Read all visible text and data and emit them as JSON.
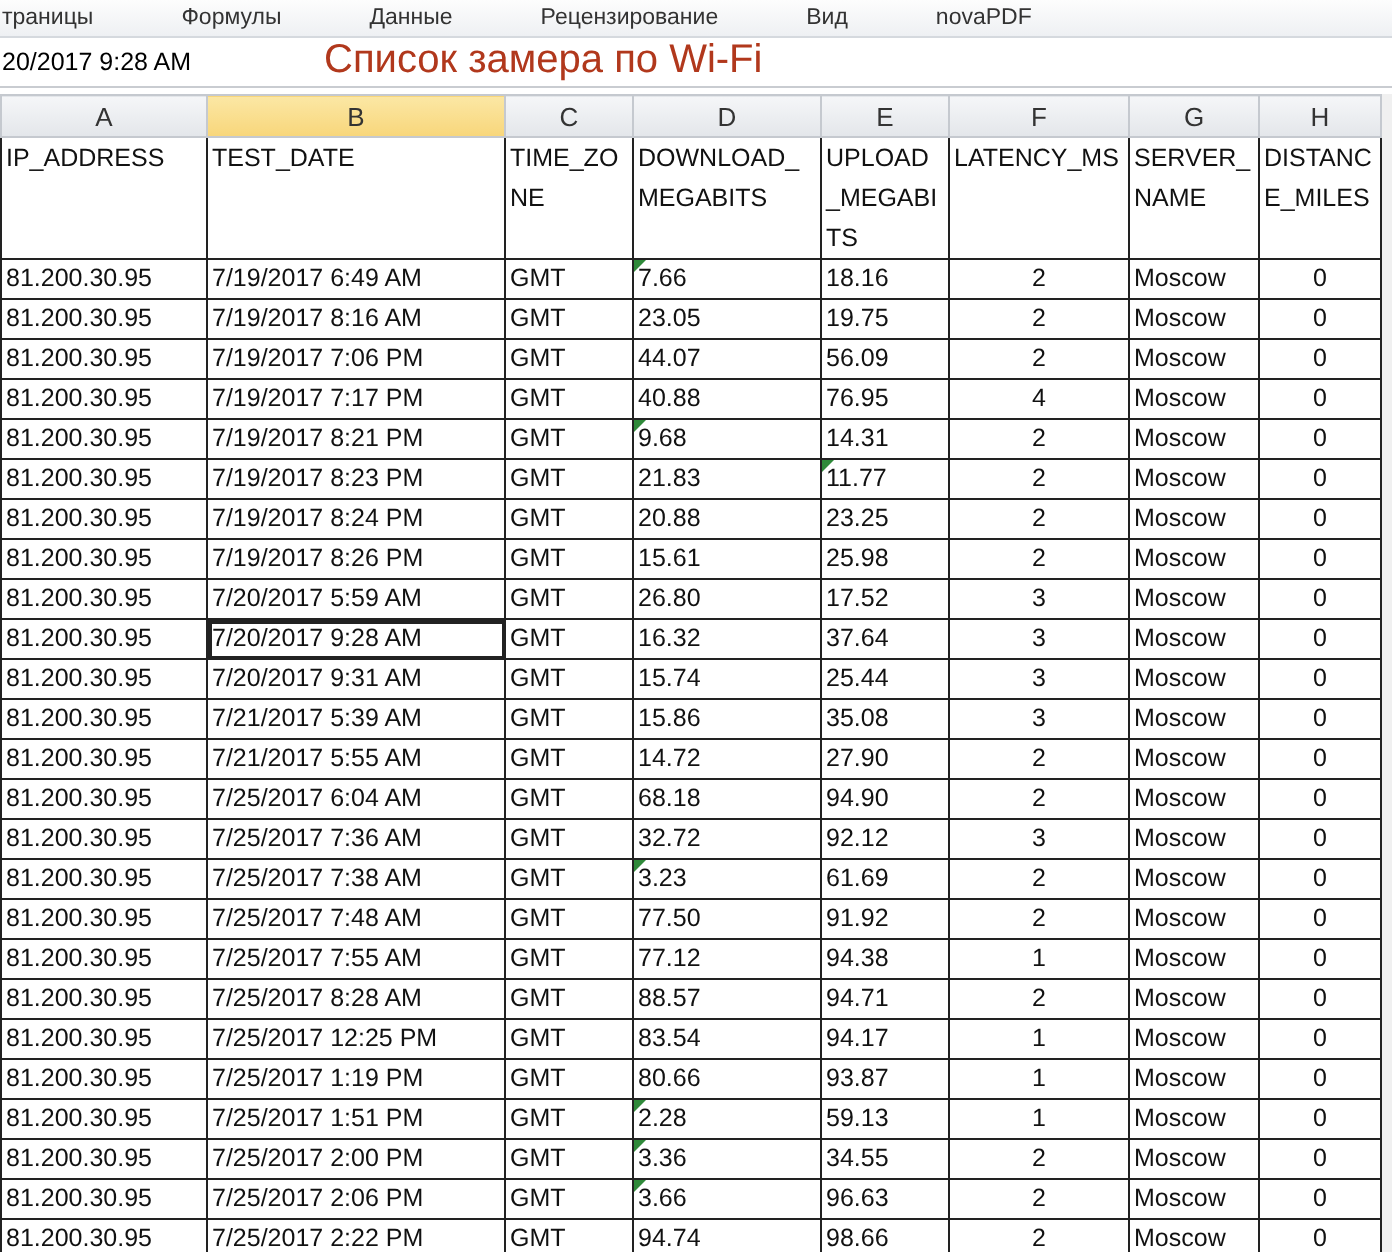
{
  "ribbon_tabs": [
    "траницы",
    "Формулы",
    "Данные",
    "Рецензирование",
    "Вид",
    "novaPDF"
  ],
  "formula_bar": {
    "value": "20/2017 9:28 AM"
  },
  "overlay_title": "Список замера по Wi-Fi",
  "column_letters": [
    {
      "label": "A",
      "selected": false
    },
    {
      "label": "B",
      "selected": true
    },
    {
      "label": "C",
      "selected": false
    },
    {
      "label": "D",
      "selected": false
    },
    {
      "label": "E",
      "selected": false
    },
    {
      "label": "F",
      "selected": false
    },
    {
      "label": "G",
      "selected": false
    },
    {
      "label": "H",
      "selected": false
    }
  ],
  "headers": [
    "IP_ADDRESS",
    "TEST_DATE",
    "TIME_ZO\nNE",
    "DOWNLOAD_\nMEGABITS",
    "UPLOAD\n_MEGABI\nTS",
    "LATENCY_MS",
    "SERVER_\nNAME",
    "DISTANC\nE_MILES"
  ],
  "rows": [
    {
      "ip": "81.200.30.95",
      "date": "7/19/2017 6:49 AM",
      "tz": "GMT",
      "download": "7.66",
      "upload": "18.16",
      "latency": "2",
      "server": "Moscow",
      "distance": "0",
      "download_flagged": true,
      "upload_flagged": false,
      "selected": false
    },
    {
      "ip": "81.200.30.95",
      "date": "7/19/2017 8:16 AM",
      "tz": "GMT",
      "download": "23.05",
      "upload": "19.75",
      "latency": "2",
      "server": "Moscow",
      "distance": "0",
      "download_flagged": false,
      "upload_flagged": false,
      "selected": false
    },
    {
      "ip": "81.200.30.95",
      "date": "7/19/2017 7:06 PM",
      "tz": "GMT",
      "download": "44.07",
      "upload": "56.09",
      "latency": "2",
      "server": "Moscow",
      "distance": "0",
      "download_flagged": false,
      "upload_flagged": false,
      "selected": false
    },
    {
      "ip": "81.200.30.95",
      "date": "7/19/2017 7:17 PM",
      "tz": "GMT",
      "download": "40.88",
      "upload": "76.95",
      "latency": "4",
      "server": "Moscow",
      "distance": "0",
      "download_flagged": false,
      "upload_flagged": false,
      "selected": false
    },
    {
      "ip": "81.200.30.95",
      "date": "7/19/2017 8:21 PM",
      "tz": "GMT",
      "download": "9.68",
      "upload": "14.31",
      "latency": "2",
      "server": "Moscow",
      "distance": "0",
      "download_flagged": true,
      "upload_flagged": false,
      "selected": false
    },
    {
      "ip": "81.200.30.95",
      "date": "7/19/2017 8:23 PM",
      "tz": "GMT",
      "download": "21.83",
      "upload": "11.77",
      "latency": "2",
      "server": "Moscow",
      "distance": "0",
      "download_flagged": false,
      "upload_flagged": true,
      "selected": false
    },
    {
      "ip": "81.200.30.95",
      "date": "7/19/2017 8:24 PM",
      "tz": "GMT",
      "download": "20.88",
      "upload": "23.25",
      "latency": "2",
      "server": "Moscow",
      "distance": "0",
      "download_flagged": false,
      "upload_flagged": false,
      "selected": false
    },
    {
      "ip": "81.200.30.95",
      "date": "7/19/2017 8:26 PM",
      "tz": "GMT",
      "download": "15.61",
      "upload": "25.98",
      "latency": "2",
      "server": "Moscow",
      "distance": "0",
      "download_flagged": false,
      "upload_flagged": false,
      "selected": false
    },
    {
      "ip": "81.200.30.95",
      "date": "7/20/2017 5:59 AM",
      "tz": "GMT",
      "download": "26.80",
      "upload": "17.52",
      "latency": "3",
      "server": "Moscow",
      "distance": "0",
      "download_flagged": false,
      "upload_flagged": false,
      "selected": false
    },
    {
      "ip": "81.200.30.95",
      "date": "7/20/2017 9:28 AM",
      "tz": "GMT",
      "download": "16.32",
      "upload": "37.64",
      "latency": "3",
      "server": "Moscow",
      "distance": "0",
      "download_flagged": false,
      "upload_flagged": false,
      "selected": true
    },
    {
      "ip": "81.200.30.95",
      "date": "7/20/2017 9:31 AM",
      "tz": "GMT",
      "download": "15.74",
      "upload": "25.44",
      "latency": "3",
      "server": "Moscow",
      "distance": "0",
      "download_flagged": false,
      "upload_flagged": false,
      "selected": false
    },
    {
      "ip": "81.200.30.95",
      "date": "7/21/2017 5:39 AM",
      "tz": "GMT",
      "download": "15.86",
      "upload": "35.08",
      "latency": "3",
      "server": "Moscow",
      "distance": "0",
      "download_flagged": false,
      "upload_flagged": false,
      "selected": false
    },
    {
      "ip": "81.200.30.95",
      "date": "7/21/2017 5:55 AM",
      "tz": "GMT",
      "download": "14.72",
      "upload": "27.90",
      "latency": "2",
      "server": "Moscow",
      "distance": "0",
      "download_flagged": false,
      "upload_flagged": false,
      "selected": false
    },
    {
      "ip": "81.200.30.95",
      "date": "7/25/2017 6:04 AM",
      "tz": "GMT",
      "download": "68.18",
      "upload": "94.90",
      "latency": "2",
      "server": "Moscow",
      "distance": "0",
      "download_flagged": false,
      "upload_flagged": false,
      "selected": false
    },
    {
      "ip": "81.200.30.95",
      "date": "7/25/2017 7:36 AM",
      "tz": "GMT",
      "download": "32.72",
      "upload": "92.12",
      "latency": "3",
      "server": "Moscow",
      "distance": "0",
      "download_flagged": false,
      "upload_flagged": false,
      "selected": false
    },
    {
      "ip": "81.200.30.95",
      "date": "7/25/2017 7:38 AM",
      "tz": "GMT",
      "download": "3.23",
      "upload": "61.69",
      "latency": "2",
      "server": "Moscow",
      "distance": "0",
      "download_flagged": true,
      "upload_flagged": false,
      "selected": false
    },
    {
      "ip": "81.200.30.95",
      "date": "7/25/2017 7:48 AM",
      "tz": "GMT",
      "download": "77.50",
      "upload": "91.92",
      "latency": "2",
      "server": "Moscow",
      "distance": "0",
      "download_flagged": false,
      "upload_flagged": false,
      "selected": false
    },
    {
      "ip": "81.200.30.95",
      "date": "7/25/2017 7:55 AM",
      "tz": "GMT",
      "download": "77.12",
      "upload": "94.38",
      "latency": "1",
      "server": "Moscow",
      "distance": "0",
      "download_flagged": false,
      "upload_flagged": false,
      "selected": false
    },
    {
      "ip": "81.200.30.95",
      "date": "7/25/2017 8:28 AM",
      "tz": "GMT",
      "download": "88.57",
      "upload": "94.71",
      "latency": "2",
      "server": "Moscow",
      "distance": "0",
      "download_flagged": false,
      "upload_flagged": false,
      "selected": false
    },
    {
      "ip": "81.200.30.95",
      "date": "7/25/2017 12:25 PM",
      "tz": "GMT",
      "download": "83.54",
      "upload": "94.17",
      "latency": "1",
      "server": "Moscow",
      "distance": "0",
      "download_flagged": false,
      "upload_flagged": false,
      "selected": false
    },
    {
      "ip": "81.200.30.95",
      "date": "7/25/2017 1:19 PM",
      "tz": "GMT",
      "download": "80.66",
      "upload": "93.87",
      "latency": "1",
      "server": "Moscow",
      "distance": "0",
      "download_flagged": false,
      "upload_flagged": false,
      "selected": false
    },
    {
      "ip": "81.200.30.95",
      "date": "7/25/2017 1:51 PM",
      "tz": "GMT",
      "download": "2.28",
      "upload": "59.13",
      "latency": "1",
      "server": "Moscow",
      "distance": "0",
      "download_flagged": true,
      "upload_flagged": false,
      "selected": false
    },
    {
      "ip": "81.200.30.95",
      "date": "7/25/2017 2:00 PM",
      "tz": "GMT",
      "download": "3.36",
      "upload": "34.55",
      "latency": "2",
      "server": "Moscow",
      "distance": "0",
      "download_flagged": true,
      "upload_flagged": false,
      "selected": false
    },
    {
      "ip": "81.200.30.95",
      "date": "7/25/2017 2:06 PM",
      "tz": "GMT",
      "download": "3.66",
      "upload": "96.63",
      "latency": "2",
      "server": "Moscow",
      "distance": "0",
      "download_flagged": true,
      "upload_flagged": false,
      "selected": false
    },
    {
      "ip": "81.200.30.95",
      "date": "7/25/2017 2:22 PM",
      "tz": "GMT",
      "download": "94.74",
      "upload": "98.66",
      "latency": "2",
      "server": "Moscow",
      "distance": "0",
      "download_flagged": false,
      "upload_flagged": false,
      "selected": false
    }
  ]
}
